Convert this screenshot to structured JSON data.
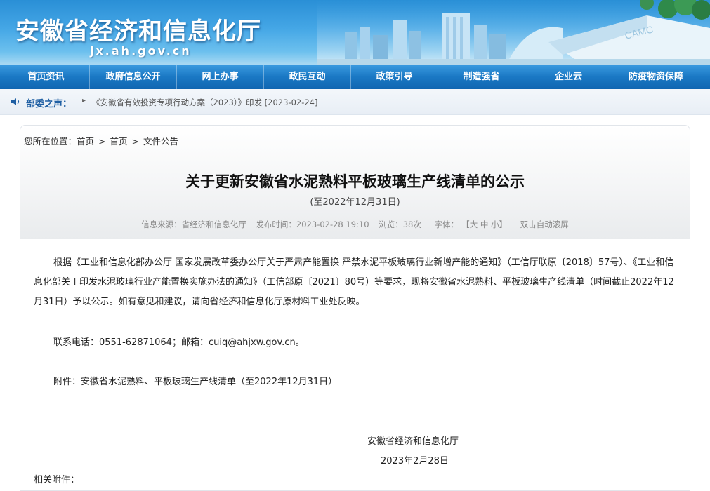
{
  "header": {
    "site_title": "安徽省经济和信息化厅",
    "site_domain": "jx.ah.gov.cn"
  },
  "nav": {
    "items": [
      {
        "label": "首页资讯"
      },
      {
        "label": "政府信息公开"
      },
      {
        "label": "网上办事"
      },
      {
        "label": "政民互动"
      },
      {
        "label": "政策引导"
      },
      {
        "label": "制造强省"
      },
      {
        "label": "企业云"
      },
      {
        "label": "防疫物资保障"
      }
    ]
  },
  "notice": {
    "label": "部委之声：",
    "arrow": "▸",
    "link_text": "《安徽省有效投资专项行动方案（2023）》印发 [2023-02-24]"
  },
  "breadcrumb": {
    "prefix": "您所在位置：",
    "items": [
      "首页",
      "首页",
      "文件公告"
    ],
    "separator": ">"
  },
  "article": {
    "title": "关于更新安徽省水泥熟料平板玻璃生产线清单的公示",
    "subtitle": "(至2022年12月31日)",
    "meta": {
      "source": "信息来源：省经济和信息化厅",
      "published": "发布时间：2023-02-28 19:10",
      "views": "浏览：38次",
      "font_size_label": "字体：",
      "font_size_options": "【大 中 小】",
      "auto_scroll": "双击自动滚屏"
    },
    "paragraph1": "根据《工业和信息化部办公厅 国家发展改革委办公厅关于严肃产能置换 严禁水泥平板玻璃行业新增产能的通知》（工信厅联原〔2018〕57号）、《工业和信息化部关于印发水泥玻璃行业产能置换实施办法的通知》（工信部原〔2021〕80号）等要求，现将安徽省水泥熟料、平板玻璃生产线清单（时间截止2022年12月31日）予以公示。如有意见和建议，请向省经济和信息化厅原材料工业处反映。",
    "contact": "联系电话：0551-62871064；邮箱：cuiq@ahjxw.gov.cn。",
    "attachment": "附件：安徽省水泥熟料、平板玻璃生产线清单（至2022年12月31日）",
    "sign_org": "安徽省经济和信息化厅",
    "sign_date": "2023年2月28日",
    "related_label": "相关附件："
  },
  "colors": {
    "nav_bg": "#1a78c4",
    "banner_bg": "#2a8fd6",
    "notice_label": "#1f5fa3"
  }
}
